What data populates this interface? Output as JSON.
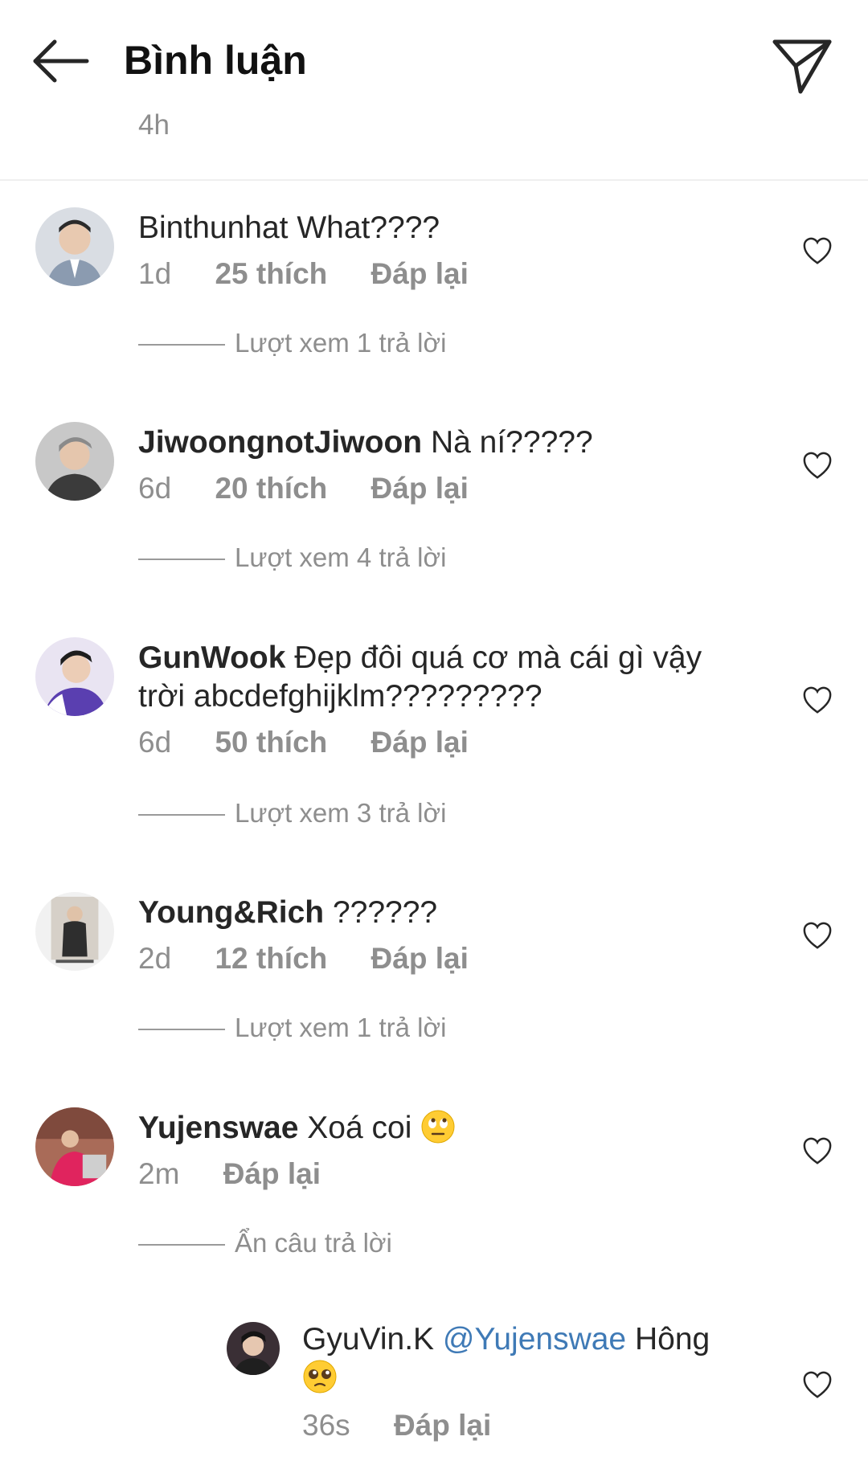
{
  "header": {
    "title": "Bình luận",
    "post_time": "4h"
  },
  "comments": [
    {
      "username": "",
      "text": "Binthunhat What????",
      "time": "1d",
      "likes": "25 thích",
      "reply_label": "Đáp lại",
      "view_replies": "Lượt xem 1 trả lời"
    },
    {
      "username": "JiwoongnotJiwoon",
      "text": "Nà ní?????",
      "time": "6d",
      "likes": "20 thích",
      "reply_label": "Đáp lại",
      "view_replies": "Lượt xem 4 trả lời"
    },
    {
      "username": "GunWook",
      "text": "Đẹp đôi quá cơ mà cái gì vậy trời abcdefghijklm?????????",
      "time": "6d",
      "likes": "50 thích",
      "reply_label": "Đáp lại",
      "view_replies": "Lượt xem 3 trả lời"
    },
    {
      "username": "Young&Rich",
      "text": "??????",
      "time": "2d",
      "likes": "12 thích",
      "reply_label": "Đáp lại",
      "view_replies": "Lượt xem 1 trả lời"
    },
    {
      "username": "Yujenswae",
      "text": "Xoá coi",
      "emoji": "eye-roll-emoji",
      "time": "2m",
      "reply_label": "Đáp lại",
      "hide_replies": "Ẩn câu trả lời"
    }
  ],
  "reply": {
    "username": "GyuVin.K",
    "mention": "@Yujenswae",
    "text": "Hông",
    "emoji": "pleading-face-emoji",
    "time": "36s",
    "reply_label": "Đáp lại"
  },
  "colors": {
    "text": "#262626",
    "secondary": "#8e8e8e",
    "mention": "#3f7ab6",
    "divider": "#efefef"
  }
}
